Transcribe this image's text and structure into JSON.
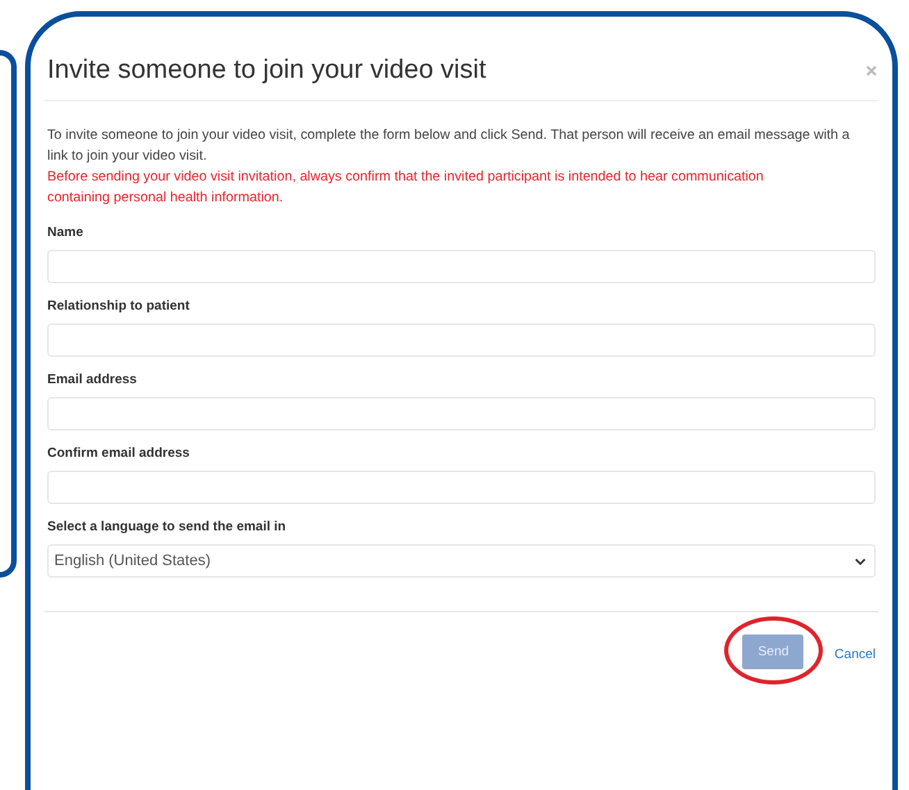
{
  "dialog": {
    "title": "Invite someone to join your video visit",
    "intro": "To invite someone to join your video visit, complete the form below and click Send. That person will receive an email message with a link to join your video visit.",
    "warning": "Before sending your video visit invitation, always confirm that the invited participant is intended to hear communication containing personal health information.",
    "fields": [
      {
        "kind": "text",
        "label": "Name"
      },
      {
        "kind": "text",
        "label": "Relationship to patient"
      },
      {
        "kind": "text",
        "label": "Email address"
      },
      {
        "kind": "text",
        "label": "Confirm email address"
      },
      {
        "kind": "select",
        "label": "Select a language to send the email in",
        "value": "English (United States)"
      }
    ],
    "buttons": [
      {
        "kind": "button",
        "label": "Send",
        "disabled": true,
        "highlighted": true
      },
      {
        "kind": "link",
        "label": "Cancel",
        "disabled": false,
        "highlighted": false
      }
    ]
  }
}
